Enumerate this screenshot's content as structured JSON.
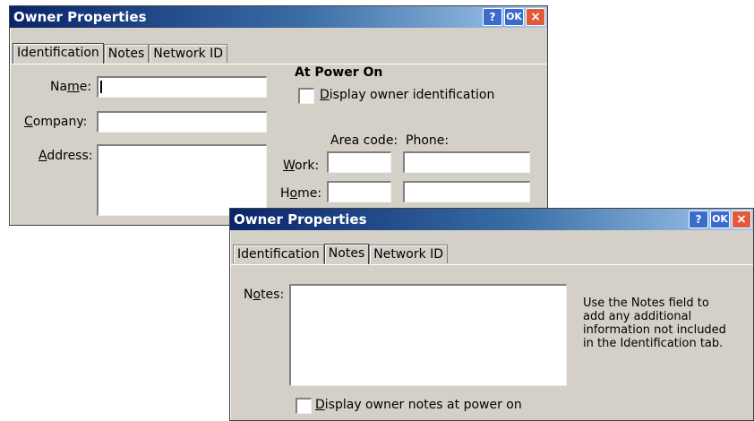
{
  "window1": {
    "title": "Owner Properties",
    "help_btn": "?",
    "ok_btn": "OK",
    "close_btn": "×",
    "tabs": [
      "Identification",
      "Notes",
      "Network ID"
    ],
    "name": {
      "pre": "Na",
      "u": "m",
      "post": "e:"
    },
    "company": {
      "pre": "",
      "u": "C",
      "post": "ompany:"
    },
    "address": {
      "pre": "",
      "u": "A",
      "post": "ddress:"
    },
    "at_power_on": "At Power On",
    "display_owner_id": {
      "pre": "",
      "u": "D",
      "post": "isplay owner identification"
    },
    "area_code": "Area code:",
    "phone": "Phone:",
    "work": {
      "pre": "",
      "u": "W",
      "post": "ork:"
    },
    "home": {
      "pre": "H",
      "u": "o",
      "post": "me:"
    }
  },
  "window2": {
    "title": "Owner Properties",
    "help_btn": "?",
    "ok_btn": "OK",
    "close_btn": "×",
    "tabs": [
      "Identification",
      "Notes",
      "Network ID"
    ],
    "notes": {
      "pre": "N",
      "u": "o",
      "post": "tes:"
    },
    "help_lines": [
      "Use the Notes field to",
      "add any additional",
      "information not included",
      "in the Identification tab."
    ],
    "display_notes": {
      "pre": "",
      "u": "D",
      "post": "isplay owner notes at power on"
    }
  }
}
